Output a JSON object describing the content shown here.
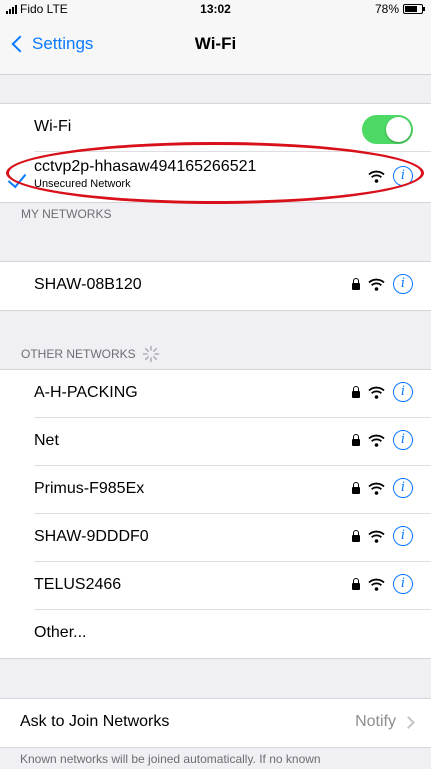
{
  "status_bar": {
    "carrier": "Fido  LTE",
    "time": "13:02",
    "battery": "78%",
    "battery_level": 0.78
  },
  "nav": {
    "back_label": "Settings",
    "title": "Wi-Fi"
  },
  "wifi": {
    "label": "Wi-Fi",
    "enabled": true,
    "toggle_color": "#4cd964"
  },
  "connected": {
    "ssid": "cctvp2p-hhasaw494165266521",
    "status": "Unsecured Network",
    "accent": "#0a7aff"
  },
  "my_networks": {
    "header": "MY NETWORKS",
    "items": [
      {
        "name": "SHAW-08B120",
        "locked": true
      }
    ]
  },
  "other_networks": {
    "header": "OTHER NETWORKS",
    "items": [
      {
        "name": "A-H-PACKING",
        "locked": true
      },
      {
        "name": "Net",
        "locked": true
      },
      {
        "name": "Primus-F985Ex",
        "locked": true
      },
      {
        "name": "SHAW-9DDDF0",
        "locked": true
      },
      {
        "name": "TELUS2466",
        "locked": true
      }
    ],
    "other_label": "Other..."
  },
  "ask_to_join": {
    "label": "Ask to Join Networks",
    "value": "Notify"
  },
  "footer_text": "Known networks will be joined automatically. If no known",
  "icons": {
    "wifi": "wifi-icon",
    "lock": "lock-icon",
    "info": "info-icon",
    "check": "checkmark-icon",
    "spinner": "spinner-icon",
    "chevron": "chevron-right-icon"
  },
  "annotation_color": "#d8101a"
}
